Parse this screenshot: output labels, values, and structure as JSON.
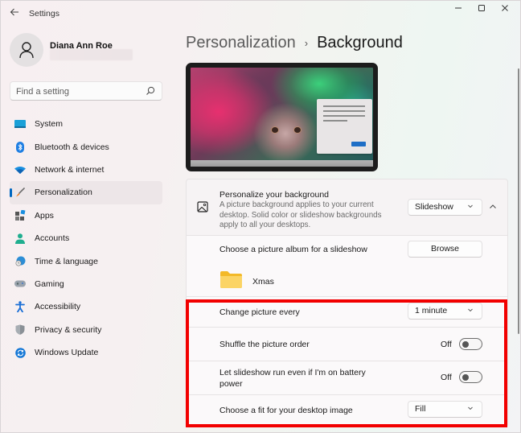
{
  "window": {
    "title": "Settings",
    "back_icon": "back-arrow-icon",
    "controls": {
      "minimize": "minimize-icon",
      "maximize": "maximize-icon",
      "close": "close-icon"
    }
  },
  "user": {
    "name": "Diana Ann Roe",
    "avatar_icon": "person-icon"
  },
  "search": {
    "placeholder": "Find a setting",
    "value": "",
    "icon": "search-icon"
  },
  "sidebar": {
    "items": [
      {
        "label": "System",
        "icon": "system-icon",
        "active": false
      },
      {
        "label": "Bluetooth & devices",
        "icon": "bluetooth-icon",
        "active": false
      },
      {
        "label": "Network & internet",
        "icon": "wifi-icon",
        "active": false
      },
      {
        "label": "Personalization",
        "icon": "brush-icon",
        "active": true
      },
      {
        "label": "Apps",
        "icon": "apps-icon",
        "active": false
      },
      {
        "label": "Accounts",
        "icon": "accounts-icon",
        "active": false
      },
      {
        "label": "Time & language",
        "icon": "globe-clock-icon",
        "active": false
      },
      {
        "label": "Gaming",
        "icon": "gamepad-icon",
        "active": false
      },
      {
        "label": "Accessibility",
        "icon": "accessibility-icon",
        "active": false
      },
      {
        "label": "Privacy & security",
        "icon": "shield-icon",
        "active": false
      },
      {
        "label": "Windows Update",
        "icon": "update-icon",
        "active": false
      }
    ],
    "accent": "#0067c0"
  },
  "breadcrumb": {
    "parent": "Personalization",
    "separator": "›",
    "current": "Background"
  },
  "background": {
    "title": "Personalize your background",
    "description": "A picture background applies to your current desktop. Solid color or slideshow backgrounds apply to all your desktops.",
    "type_value": "Slideshow",
    "collapse_icon": "chevron-up-icon"
  },
  "album": {
    "label": "Choose a picture album for a slideshow",
    "browse_label": "Browse",
    "folder_name": "Xmas",
    "folder_icon": "folder-icon"
  },
  "settings": {
    "change_every": {
      "label": "Change picture every",
      "value": "1 minute"
    },
    "shuffle": {
      "label": "Shuffle the picture order",
      "state": "Off"
    },
    "battery": {
      "label": "Let slideshow run even if I'm on battery power",
      "state": "Off"
    },
    "fit": {
      "label": "Choose a fit for your desktop image",
      "value": "Fill"
    }
  },
  "highlight_color": "#f20000"
}
